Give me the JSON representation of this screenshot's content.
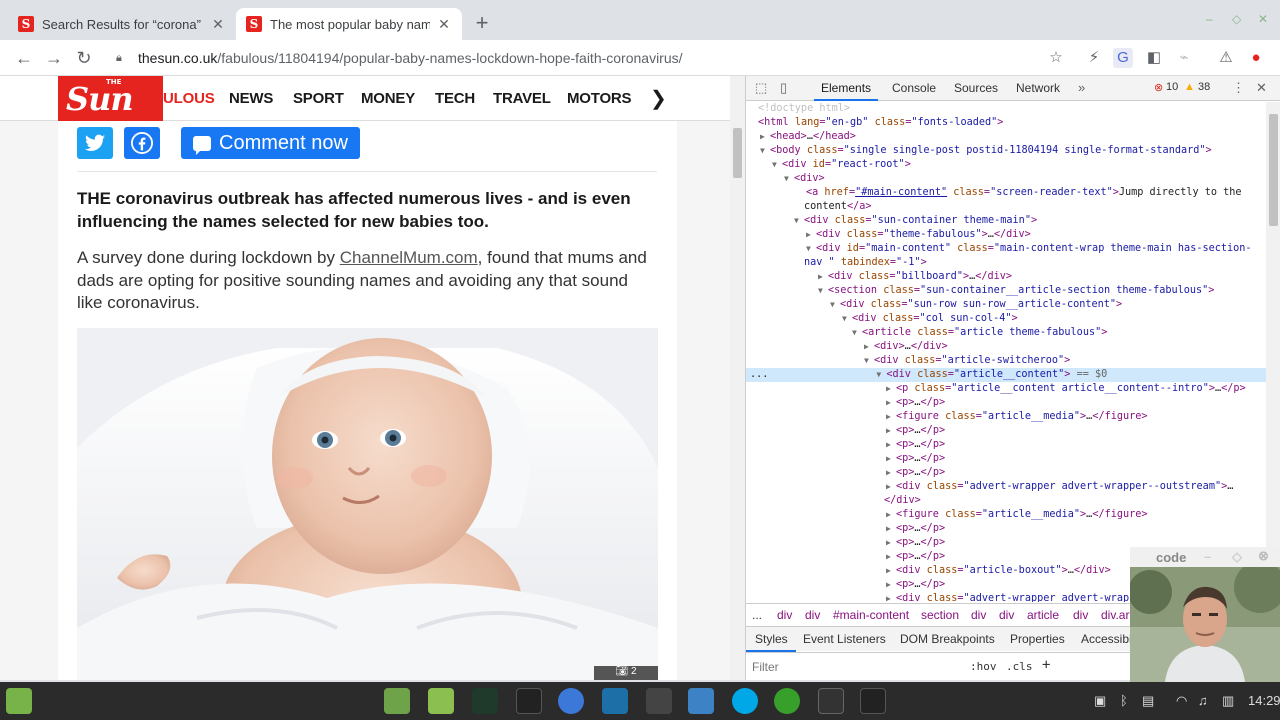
{
  "browser": {
    "tabs": [
      {
        "title": "Search Results for “corona” – Th",
        "favicon": "S",
        "active": false
      },
      {
        "title": "The most popular baby names",
        "favicon": "S",
        "active": true
      }
    ],
    "url_host": "thesun.co.uk",
    "url_path": "/fabulous/11804194/popular-baby-names-lockdown-hope-faith-coronavirus/"
  },
  "site": {
    "logo_the": "THE",
    "logo_sun": "Sun",
    "nav": [
      "ULOUS",
      "NEWS",
      "SPORT",
      "MONEY",
      "TECH",
      "TRAVEL",
      "MOTORS"
    ],
    "brand_color": "#e5231f"
  },
  "article": {
    "comment_label": "Comment now",
    "intro": "THE coronavirus outbreak has affected numerous lives - and is even influencing the names selected for new babies too.",
    "para_before": "A survey done during lockdown by ",
    "para_link": "ChannelMum.com",
    "para_after": ", found that mums and dads are opting for positive sounding names and avoiding any that sound like coronavirus."
  },
  "devtools": {
    "tabs": [
      "Elements",
      "Console",
      "Sources",
      "Network"
    ],
    "errors": "10",
    "warnings": "38",
    "breadcrumbs": [
      "div",
      "div",
      "#main-content",
      "section",
      "div",
      "div",
      "article",
      "div",
      "div.art"
    ],
    "bottom_tabs": [
      "Styles",
      "Event Listeners",
      "DOM Breakpoints",
      "Properties",
      "Accessibil"
    ],
    "filter_placeholder": "Filter",
    "hov": ":hov",
    "cls": ".cls"
  },
  "cam_title": "code",
  "clock": "14:29"
}
